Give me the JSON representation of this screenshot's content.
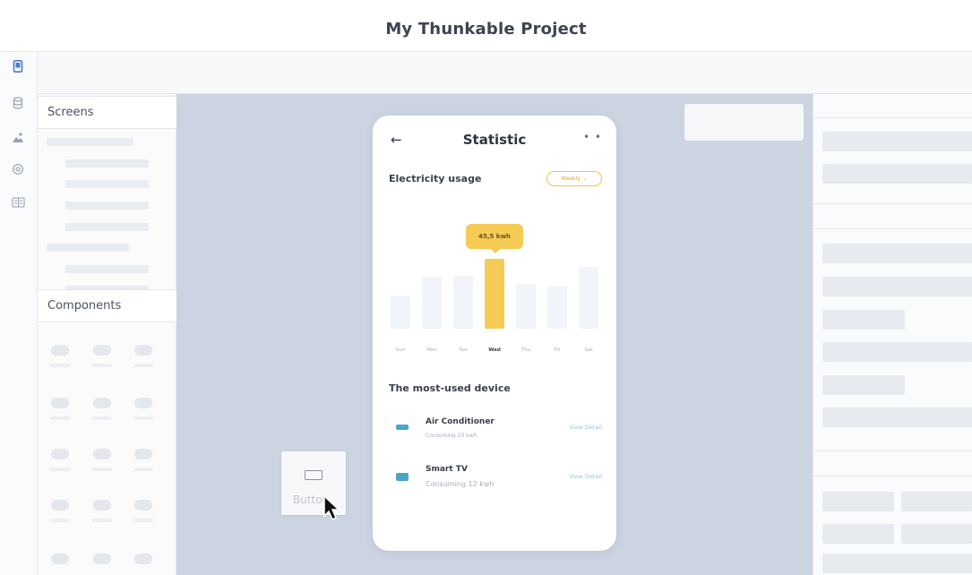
{
  "window": {
    "title": "My Thunkable Project"
  },
  "icon_rail": [
    {
      "icon": "phone-icon",
      "active": true
    },
    {
      "icon": "database-icon",
      "active": false
    },
    {
      "icon": "image-assets-icon",
      "active": false
    },
    {
      "icon": "settings-gear-icon",
      "active": false
    },
    {
      "icon": "book-icon",
      "active": false
    }
  ],
  "left_panel": {
    "screens_label": "Screens",
    "components_label": "Components"
  },
  "phone": {
    "title": "Statistic",
    "back_glyph": "←",
    "more_glyph": "• •",
    "usage_label": "Electricity usage",
    "period": "Weekly",
    "tooltip": "45,5 kwh",
    "bars": [
      {
        "day": "Sun",
        "level": 0.47,
        "active": false
      },
      {
        "day": "Mon",
        "level": 0.74,
        "active": false
      },
      {
        "day": "Tue",
        "level": 0.76,
        "active": false
      },
      {
        "day": "Wed",
        "level": 1.0,
        "active": true
      },
      {
        "day": "Thu",
        "level": 0.64,
        "active": false
      },
      {
        "day": "Fri",
        "level": 0.6,
        "active": false
      },
      {
        "day": "Sat",
        "level": 0.89,
        "active": false
      }
    ],
    "most_used_label": "The most-used device",
    "devices": [
      {
        "name": "Air Conditioner",
        "sub": "Consuming 10 kwh",
        "link": "View Detail",
        "icon": "air-conditioner-icon",
        "color": "#4aa6c7"
      },
      {
        "name": "Smart TV",
        "sub": "Consuming 12 kwh",
        "link": "View Detail",
        "icon": "tv-icon",
        "color": "#4aa6c7"
      }
    ]
  },
  "drag_chip": {
    "label": "Button"
  },
  "colors": {
    "canvas": "#ccd4e2",
    "accent": "#f6cb55",
    "active_icon": "#4a7bd8"
  }
}
